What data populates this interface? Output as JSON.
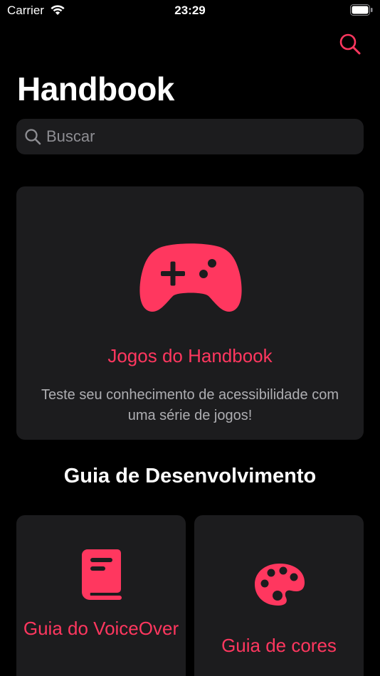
{
  "status_bar": {
    "carrier": "Carrier",
    "time": "23:29"
  },
  "header": {
    "title": "Handbook"
  },
  "search": {
    "placeholder": "Buscar",
    "value": ""
  },
  "games_card": {
    "title": "Jogos do Handbook",
    "description": "Teste seu conhecimento de acessibilidade com uma série de jogos!",
    "icon": "gamecontroller-icon"
  },
  "section": {
    "title": "Guia de Desenvolvimento"
  },
  "guides": [
    {
      "label": "Guia do VoiceOver",
      "icon": "book-icon"
    },
    {
      "label": "Guia de cores",
      "icon": "palette-icon"
    }
  ],
  "colors": {
    "accent": "#ff375f",
    "background": "#000000",
    "card": "#1c1c1e"
  }
}
